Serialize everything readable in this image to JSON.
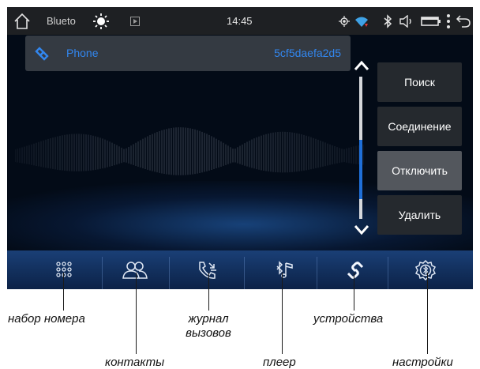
{
  "statusbar": {
    "title": "Blueto",
    "time": "14:45",
    "icons": [
      "home-icon",
      "brightness-icon",
      "play-icon",
      "location-icon",
      "wifi-icon",
      "bluetooth-icon",
      "volume-icon",
      "battery-icon",
      "more-icon",
      "back-icon"
    ]
  },
  "device": {
    "name": "Phone",
    "address": "5cf5daefa2d5",
    "icon": "bluetooth-link-icon"
  },
  "list_scroll": {
    "position": 0.55
  },
  "actions": {
    "search": "Поиск",
    "connect": "Соединение",
    "disconnect": "Отключить",
    "delete": "Удалить"
  },
  "dock": {
    "items": [
      "dialpad-icon",
      "contacts-icon",
      "call-log-icon",
      "music-player-icon",
      "devices-icon",
      "settings-icon"
    ],
    "active": "devices-icon"
  },
  "callouts": {
    "dialpad": "набор номера",
    "contacts": "контакты",
    "call_log": "журнал\nвызовов",
    "player": "плеер",
    "devices": "устройства",
    "settings": "настройки"
  },
  "colors": {
    "accent": "#3286ee",
    "screen_bg": "#030b17",
    "dock": "#1a3f76",
    "button": "#25292e",
    "button_active": "#53575d"
  }
}
